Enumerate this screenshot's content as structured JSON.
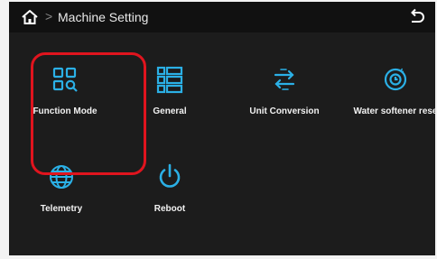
{
  "header": {
    "breadcrumb_separator": ">",
    "title": "Machine Setting",
    "home_icon": "home-icon",
    "back_icon": "back-arrow-icon"
  },
  "tiles": [
    {
      "label": "Function Mode",
      "icon": "grid-search-icon"
    },
    {
      "label": "General",
      "icon": "list-icon"
    },
    {
      "label": "Unit Conversion",
      "icon": "swap-arrows-icon"
    },
    {
      "label": "Water softener rese",
      "icon": "watch-reset-icon"
    },
    {
      "label": "Telemetry",
      "icon": "globe-icon"
    },
    {
      "label": "Reboot",
      "icon": "power-icon"
    }
  ],
  "colors": {
    "accent": "#2bb0e6",
    "highlight": "#e0141e",
    "background": "#1c1c1c",
    "topbar": "#111111"
  }
}
